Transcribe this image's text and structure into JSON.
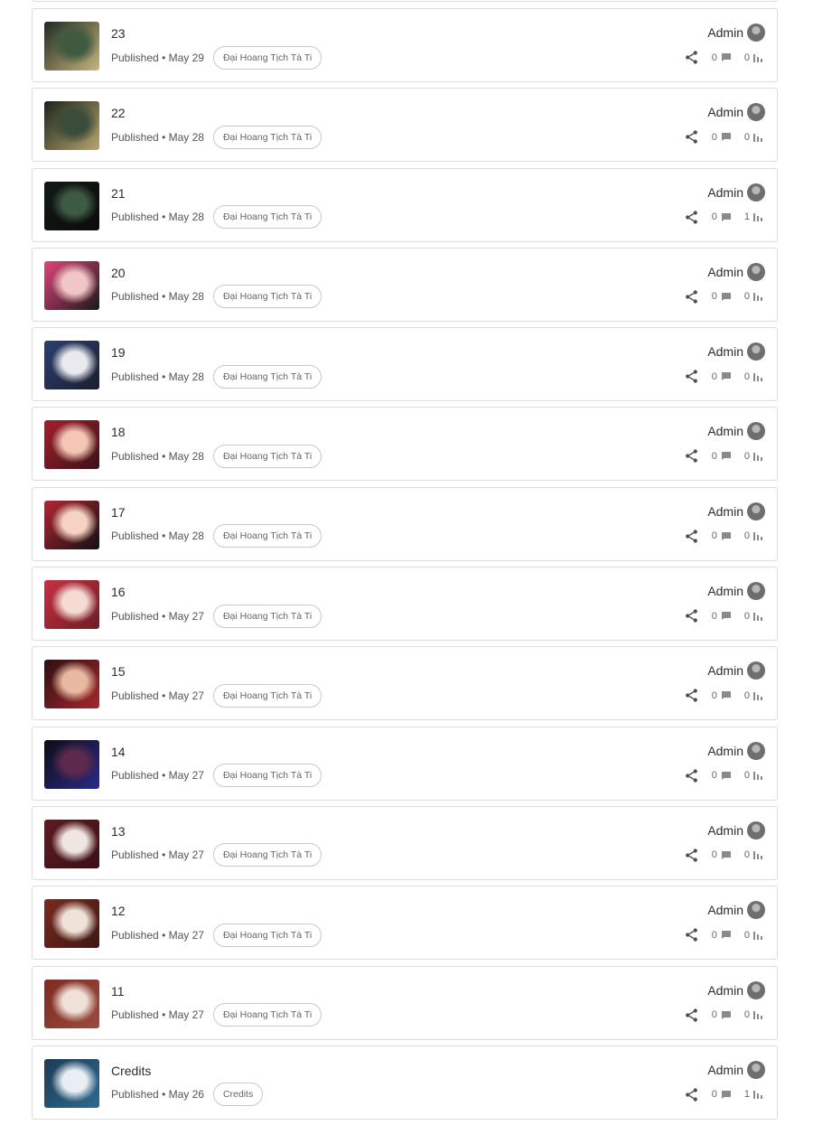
{
  "posts": [
    {
      "title": "23",
      "published": "Published",
      "date": "• May 29",
      "tag": "Đại Hoang Tịch Tà Ti",
      "author": "Admin",
      "comments": "0",
      "views": "0",
      "thumb": [
        "#1f2a22",
        "#3f5a40",
        "#c7b57d"
      ]
    },
    {
      "title": "22",
      "published": "Published",
      "date": "• May 28",
      "tag": "Đại Hoang Tịch Tà Ti",
      "author": "Admin",
      "comments": "0",
      "views": "0",
      "thumb": [
        "#1a241d",
        "#3a4c3a",
        "#b9a56c"
      ]
    },
    {
      "title": "21",
      "published": "Published",
      "date": "• May 28",
      "tag": "Đại Hoang Tịch Tà Ti",
      "author": "Admin",
      "comments": "0",
      "views": "1",
      "thumb": [
        "#111a14",
        "#3c5a44",
        "#0b0b0b"
      ]
    },
    {
      "title": "20",
      "published": "Published",
      "date": "• May 28",
      "tag": "Đại Hoang Tịch Tà Ti",
      "author": "Admin",
      "comments": "0",
      "views": "0",
      "thumb": [
        "#e0447c",
        "#f2c6c6",
        "#1a1a1a"
      ]
    },
    {
      "title": "19",
      "published": "Published",
      "date": "• May 28",
      "tag": "Đại Hoang Tịch Tà Ti",
      "author": "Admin",
      "comments": "0",
      "views": "0",
      "thumb": [
        "#2c3f6f",
        "#e9e9ef",
        "#1b1f2e"
      ]
    },
    {
      "title": "18",
      "published": "Published",
      "date": "• May 28",
      "tag": "Đại Hoang Tịch Tà Ti",
      "author": "Admin",
      "comments": "0",
      "views": "0",
      "thumb": [
        "#a31f2b",
        "#f3c7b4",
        "#3a1218"
      ]
    },
    {
      "title": "17",
      "published": "Published",
      "date": "• May 28",
      "tag": "Đại Hoang Tịch Tà Ti",
      "author": "Admin",
      "comments": "0",
      "views": "0",
      "thumb": [
        "#b42533",
        "#f6d2c3",
        "#111111"
      ]
    },
    {
      "title": "16",
      "published": "Published",
      "date": "• May 27",
      "tag": "Đại Hoang Tịch Tà Ti",
      "author": "Admin",
      "comments": "0",
      "views": "0",
      "thumb": [
        "#c73042",
        "#f5dbd3",
        "#6d1d24"
      ]
    },
    {
      "title": "15",
      "published": "Published",
      "date": "• May 27",
      "tag": "Đại Hoang Tịch Tà Ti",
      "author": "Admin",
      "comments": "0",
      "views": "0",
      "thumb": [
        "#2b1010",
        "#e8b9a0",
        "#a8262f"
      ]
    },
    {
      "title": "14",
      "published": "Published",
      "date": "• May 27",
      "tag": "Đại Hoang Tịch Tà Ti",
      "author": "Admin",
      "comments": "0",
      "views": "0",
      "thumb": [
        "#0d0d14",
        "#5b2a4d",
        "#2a2a8a"
      ]
    },
    {
      "title": "13",
      "published": "Published",
      "date": "• May 27",
      "tag": "Đại Hoang Tịch Tà Ti",
      "author": "Admin",
      "comments": "0",
      "views": "0",
      "thumb": [
        "#5e1b22",
        "#f0e5e0",
        "#3a1015"
      ]
    },
    {
      "title": "12",
      "published": "Published",
      "date": "• May 27",
      "tag": "Đại Hoang Tịch Tà Ti",
      "author": "Admin",
      "comments": "0",
      "views": "0",
      "thumb": [
        "#7a2a20",
        "#f0e2d9",
        "#3e1712"
      ]
    },
    {
      "title": "11",
      "published": "Published",
      "date": "• May 27",
      "tag": "Đại Hoang Tịch Tà Ti",
      "author": "Admin",
      "comments": "0",
      "views": "0",
      "thumb": [
        "#7e2b22",
        "#efe0d8",
        "#9a4b3f"
      ]
    },
    {
      "title": "Credits",
      "published": "Published",
      "date": "• May 26",
      "tag": "Credits",
      "author": "Admin",
      "comments": "0",
      "views": "1",
      "thumb": [
        "#1f3b55",
        "#e8eef3",
        "#2d6a8f"
      ]
    }
  ],
  "icons": {
    "share": "share-icon",
    "comment": "comment-icon",
    "views": "bar-chart-icon",
    "avatar": "user-avatar"
  }
}
